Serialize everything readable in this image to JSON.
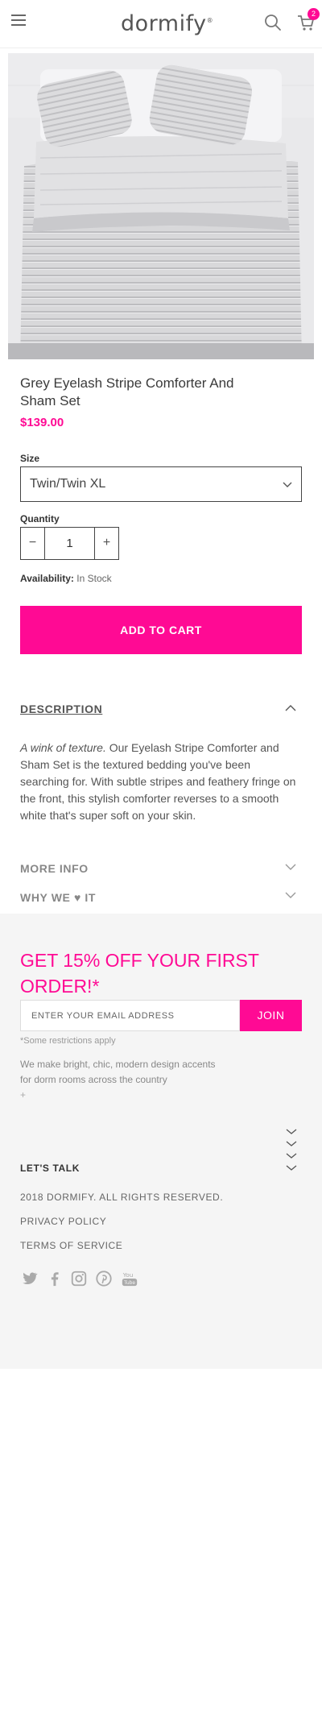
{
  "header": {
    "logo": "dormify",
    "cart_count": "2"
  },
  "product": {
    "title": "Grey Eyelash Stripe Comforter And Sham Set",
    "price": "$139.00",
    "size_label": "Size",
    "size_value": "Twin/Twin XL",
    "quantity_label": "Quantity",
    "quantity_value": "1",
    "minus": "−",
    "plus": "+",
    "availability_label": "Availability:",
    "availability_value": "In Stock",
    "add_to_cart": "ADD TO CART"
  },
  "description": {
    "heading": "DESCRIPTION",
    "lead": "A wink of texture.",
    "body": " Our Eyelash Stripe Comforter and Sham Set is the textured bedding you've been searching for. With subtle stripes and feathery fringe on the front, this stylish comforter reverses to a smooth white that's super soft on your skin."
  },
  "accordions": {
    "more_info": "MORE INFO",
    "why_we_love_it": "WHY WE ♥ IT"
  },
  "footer": {
    "promo": "GET 15% OFF YOUR FIRST ORDER!*",
    "email_placeholder": "ENTER YOUR EMAIL ADDRESS",
    "join": "JOIN",
    "restrictions": "*Some restrictions apply",
    "about": "We make bright, chic, modern design accents for dorm rooms across the country",
    "about_plus": "+",
    "lets_talk": "LET'S TALK",
    "copyright": "2018 DORMIFY. ALL RIGHTS RESERVED.",
    "privacy": "PRIVACY POLICY",
    "terms": "TERMS OF SERVICE",
    "socials": [
      "twitter-icon",
      "facebook-icon",
      "instagram-icon",
      "pinterest-icon",
      "youtube-icon"
    ]
  },
  "colors": {
    "accent": "#ff0a94",
    "footer_bg": "#f5f5f5",
    "text": "#3a3a3a"
  }
}
